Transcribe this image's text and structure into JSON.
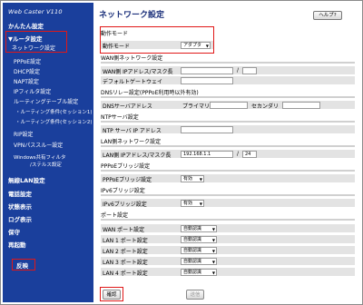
{
  "app": {
    "logo": "Web Caster V110"
  },
  "sidebar": {
    "kantan": "かんたん設定",
    "router": "▼ルータ設定",
    "network": "ネットワーク設定",
    "items": [
      "PPPoE設定",
      "DHCP設定",
      "NAPT設定",
      "IPフィルタ設定",
      "ルーティングテーブル設定",
      "・ルーティング条件(セッション1)",
      "・ルーティング条件(セッション2)",
      "RIP設定",
      "VPNパススルー設定",
      "Windows共有フィルタ"
    ],
    "windows_line2": "/ステルス設定",
    "bottom": [
      "無線LAN設定",
      "電話設定",
      "状態表示",
      "ログ表示",
      "保守",
      "再起動"
    ],
    "apply": "反映"
  },
  "main": {
    "title": "ネットワーク設定",
    "help": "ヘルプ?",
    "mode_section": "動作モード",
    "mode_label": "動作モード",
    "mode_value": "アダプタ",
    "wan_section": "WAN側ネットワーク設定",
    "wan_ip_label": "WAN側 IPアドレス/マスク長",
    "wan_slash": "/",
    "gw_label": "デフォルトゲートウェイ",
    "dns_relay_section": "DNSリレー設定(PPPoE利用時以外有効)",
    "dns_label": "DNSサーバアドレス",
    "dns_primary": "プライマリ",
    "dns_secondary": "セカンダリ",
    "ntp_section": "NTPサーバ設定",
    "ntp_label": "NTP サーバ IP アドレス",
    "lan_section": "LAN側ネットワーク設定",
    "lan_ip_label": "LAN側 IPアドレス/マスク長",
    "lan_ip_value": "192.168.1.1",
    "lan_slash": "/",
    "lan_mask_value": "24",
    "pppoe_section": "PPPoEブリッジ設定",
    "pppoe_label": "PPPoEブリッジ設定",
    "pppoe_value": "有効",
    "ipv6_section": "IPv6ブリッジ設定",
    "ipv6_label": "IPv6ブリッジ設定",
    "ipv6_value": "有効",
    "port_section": "ポート設定",
    "ports": [
      {
        "label": "WAN ポート設定",
        "value": "自動認識"
      },
      {
        "label": "LAN 1 ポート設定",
        "value": "自動認識"
      },
      {
        "label": "LAN 2 ポート設定",
        "value": "自動認識"
      },
      {
        "label": "LAN 3 ポート設定",
        "value": "自動認識"
      },
      {
        "label": "LAN 4 ポート設定",
        "value": "自動認識"
      }
    ],
    "confirm": "確認",
    "send": "送信"
  },
  "colors": {
    "sidebar_bg": "#1a3f9c",
    "highlight": "#e01818",
    "row_bg": "#e3e3e3"
  }
}
